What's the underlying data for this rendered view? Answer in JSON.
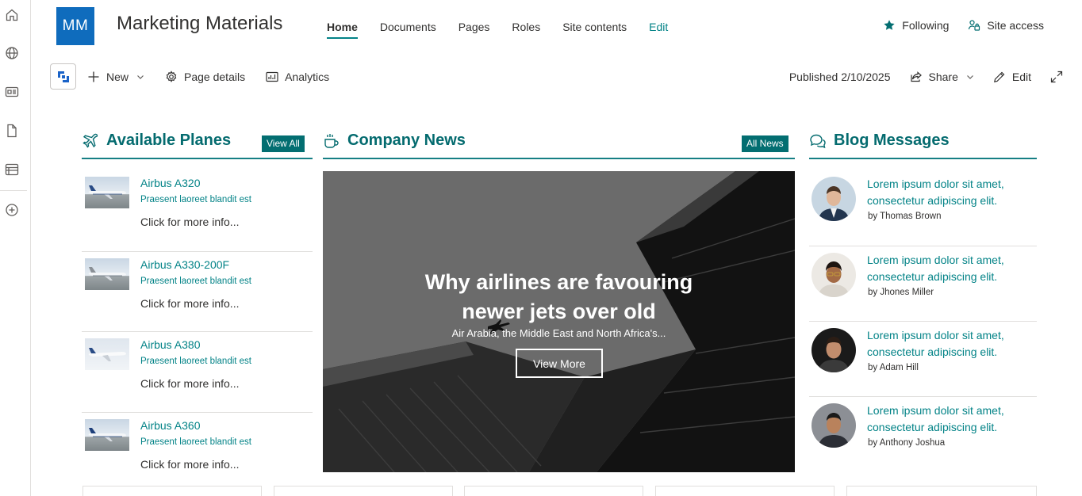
{
  "rail": {
    "icons": [
      "home-icon",
      "globe-icon",
      "news-icon",
      "document-icon",
      "list-icon",
      "add-circle-icon"
    ]
  },
  "site": {
    "logo_text": "MM",
    "title": "Marketing Materials",
    "logo_color": "#0f6cbd",
    "accent_color": "#038387"
  },
  "topnav": {
    "items": [
      {
        "label": "Home",
        "active": true
      },
      {
        "label": "Documents"
      },
      {
        "label": "Pages"
      },
      {
        "label": "Roles"
      },
      {
        "label": "Site contents"
      },
      {
        "label": "Edit"
      }
    ],
    "following_label": "Following",
    "site_access_label": "Site access"
  },
  "commandbar": {
    "new_label": "New",
    "page_details_label": "Page details",
    "analytics_label": "Analytics",
    "published_label": "Published 2/10/2025",
    "share_label": "Share",
    "edit_label": "Edit"
  },
  "planes": {
    "title": "Available Planes",
    "view_all_label": "View All",
    "items": [
      {
        "name": "Airbus A320",
        "desc": "Praesent laoreet blandit est",
        "more": "Click for more info..."
      },
      {
        "name": "Airbus A330-200F",
        "desc": "Praesent laoreet blandit est",
        "more": "Click for more info..."
      },
      {
        "name": "Airbus A380",
        "desc": "Praesent laoreet blandit est",
        "more": "Click for more info..."
      },
      {
        "name": "Airbus A360",
        "desc": "Praesent laoreet blandit est",
        "more": "Click for more info..."
      }
    ]
  },
  "news": {
    "title": "Company News",
    "all_news_label": "All News",
    "hero_title_line1": "Why airlines are favouring",
    "hero_title_line2": "newer jets over old",
    "hero_subtitle": "Air Arabia, the Middle East and North Africa's...",
    "view_more_label": "View More"
  },
  "blog": {
    "title": "Blog Messages",
    "posts": [
      {
        "title": "Lorem ipsum dolor sit amet, consectetur adipiscing elit.",
        "author": "by Thomas Brown"
      },
      {
        "title": "Lorem ipsum dolor sit amet, consectetur adipiscing elit.",
        "author": "by Jhones Miller"
      },
      {
        "title": "Lorem ipsum dolor sit amet, consectetur adipiscing elit.",
        "author": "by Adam Hill"
      },
      {
        "title": "Lorem ipsum dolor sit amet, consectetur adipiscing elit.",
        "author": "by Anthony Joshua"
      }
    ]
  }
}
